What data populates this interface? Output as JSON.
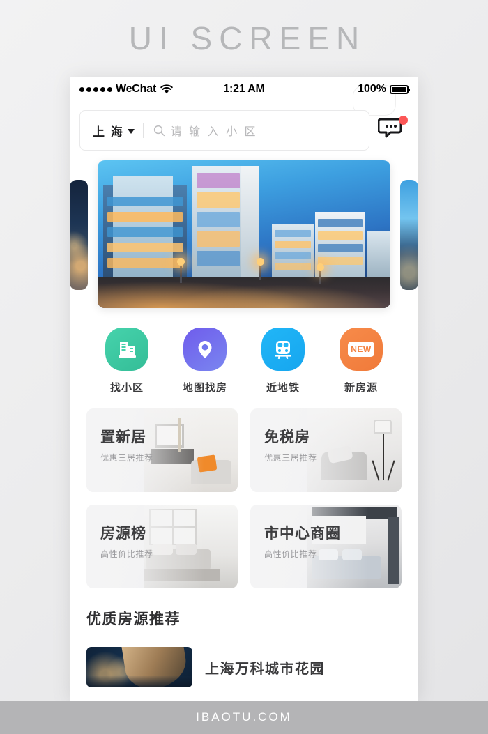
{
  "page": {
    "header_title": "UI SCREEN",
    "footer_text": "IBAOTU.COM"
  },
  "statusbar": {
    "carrier": "WeChat",
    "time": "1:21 AM",
    "battery_percent": "100%",
    "signal_icon": "signal-dots-icon",
    "wifi_icon": "wifi-icon",
    "battery_icon": "battery-icon"
  },
  "search": {
    "city": "上 海",
    "caret_icon": "chevron-down-icon",
    "search_icon": "search-icon",
    "placeholder": "请 输 入 小 区",
    "value": "",
    "message_icon": "message-bubble-icon",
    "badge": ""
  },
  "banner": {
    "slides": [
      {
        "name": "city-night-slide"
      },
      {
        "name": "modern-apartments-twilight-slide"
      },
      {
        "name": "waterfront-towers-slide"
      }
    ],
    "active_index": 1
  },
  "quick_actions": [
    {
      "label": "找小区",
      "icon": "building-icon",
      "color": "#3ecba5"
    },
    {
      "label": "地图找房",
      "icon": "map-pin-icon",
      "color": "#6e6ce8"
    },
    {
      "label": "近地铁",
      "icon": "train-icon",
      "color": "#1fb0f5"
    },
    {
      "label": "新房源",
      "icon": "new-badge-icon",
      "color": "#f58344",
      "badge_text": "NEW"
    }
  ],
  "promos": [
    {
      "title": "置新居",
      "subtitle": "优惠三居推荐",
      "image": "living-room-orange-pillow"
    },
    {
      "title": "免税房",
      "subtitle": "优惠三居推荐",
      "image": "grey-armchair-lamp"
    },
    {
      "title": "房源榜",
      "subtitle": "高性价比推荐",
      "image": "bedroom-window"
    },
    {
      "title": "市中心商圈",
      "subtitle": "高性价比推荐",
      "image": "modern-bedroom"
    }
  ],
  "recommend": {
    "title": "优质房源推荐",
    "items": [
      {
        "name": "上海万科城市花园",
        "thumb": "building-night-thumb"
      }
    ]
  },
  "colors": {
    "accent_green": "#3ecba5",
    "accent_purple": "#6e6ce8",
    "accent_blue": "#1fb0f5",
    "accent_orange": "#f58344",
    "badge_red": "#fc5757",
    "footer_bar": "#b4b4b6",
    "header_text": "#b6b7b9"
  }
}
